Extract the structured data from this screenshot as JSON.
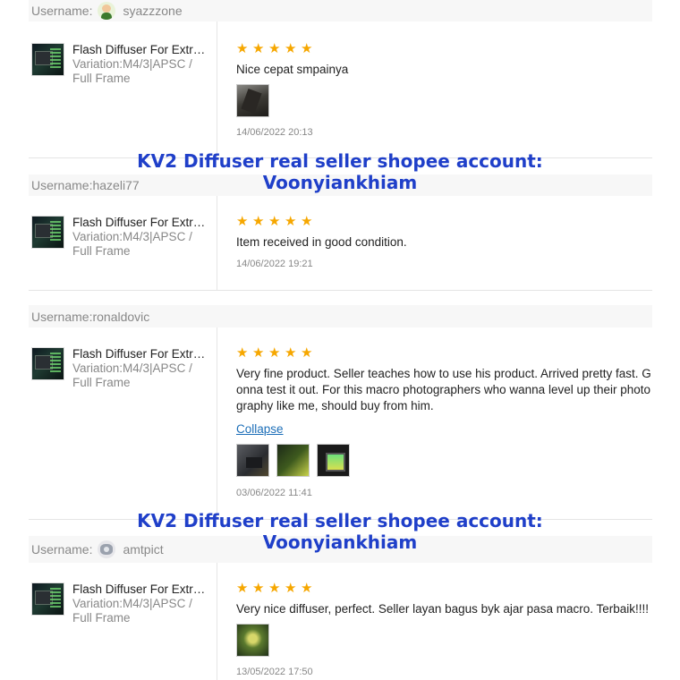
{
  "reviews": [
    {
      "username_label": "Username:",
      "username": "syazzzone",
      "avatar": "avatar-person",
      "product_name": "Flash Diffuser For Extr…",
      "variation": "Variation:M4/3|APSC / Full Frame",
      "rating": 5,
      "comment": "Nice cepat smpainya",
      "photos": [
        "review-photo"
      ],
      "date": "14/06/2022 20:13"
    },
    {
      "username_label": "Username:",
      "username": "hazeli77",
      "product_name": "Flash Diffuser For Extr…",
      "variation": "Variation:M4/3|APSC / Full Frame",
      "rating": 5,
      "comment": "Item received in good condition.",
      "photos": [],
      "date": "14/06/2022 19:21"
    },
    {
      "username_label": "Username:",
      "username": "ronaldovic",
      "product_name": "Flash Diffuser For Extr…",
      "variation": "Variation:M4/3|APSC / Full Frame",
      "rating": 5,
      "comment": "Very fine product. Seller teaches how to use his product. Arrived pretty fast. Gonna test it out. For this macro photographers who wanna level up their photography like me, should buy from him.",
      "collapse_label": "Collapse",
      "photos": [
        "review-photo",
        "review-photo",
        "review-photo"
      ],
      "date": "03/06/2022 11:41"
    },
    {
      "username_label": "Username:",
      "username": "amtpict",
      "avatar": "avatar-camera",
      "product_name": "Flash Diffuser For Extr…",
      "variation": "Variation:M4/3|APSC / Full Frame",
      "rating": 5,
      "comment": "Very nice diffuser, perfect. Seller layan bagus byk ajar pasa macro. Terbaik!!!!",
      "photos": [
        "review-photo"
      ],
      "date": "13/05/2022 17:50"
    }
  ],
  "watermarks": [
    {
      "line1": "KV2 Diffuser real seller shopee account:",
      "line2": "Voonyiankhiam"
    },
    {
      "line1": "KV2 Diffuser real seller shopee account:",
      "line2": "Voonyiankhiam"
    }
  ],
  "colors": {
    "star": "#f6a700",
    "link": "#1d6fb8",
    "watermark": "#1f3fc9",
    "header_bg": "#f7f7f7"
  },
  "icons": {
    "star": "star-icon"
  }
}
